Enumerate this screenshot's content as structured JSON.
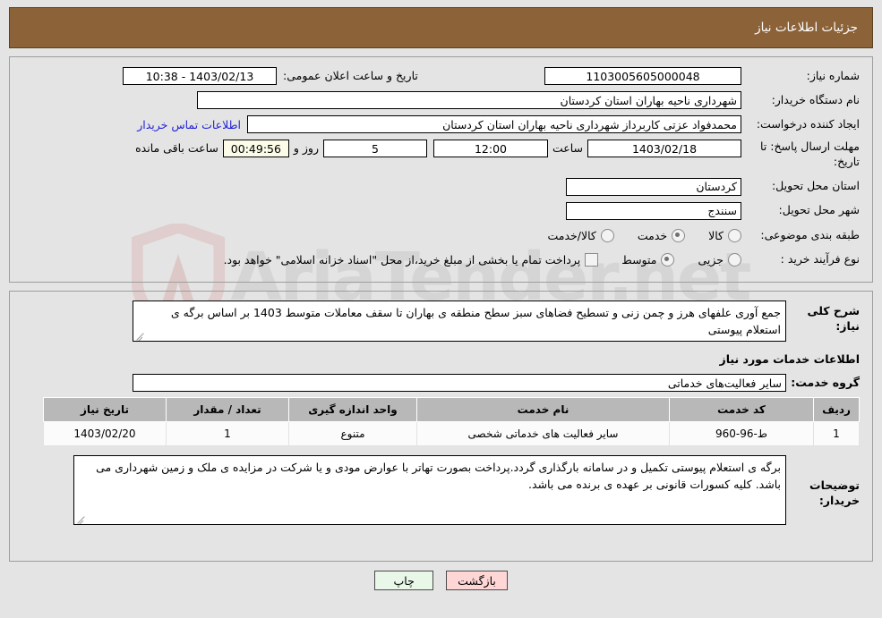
{
  "header": {
    "title": "جزئیات اطلاعات نیاز"
  },
  "form": {
    "need_number_label": "شماره نیاز:",
    "need_number_value": "1103005605000048",
    "announce_datetime_label": "تاریخ و ساعت اعلان عمومی:",
    "announce_datetime_value": "1403/02/13 - 10:38",
    "buyer_org_label": "نام دستگاه خریدار:",
    "buyer_org_value": "شهرداری ناحیه بهاران استان کردستان",
    "creator_label": "ایجاد کننده درخواست:",
    "creator_value": "محمدفواد عزتی کاربرداز شهرداری ناحیه بهاران استان کردستان",
    "contact_link": "اطلاعات تماس خریدار",
    "deadline_label": "مهلت ارسال پاسخ: تا تاریخ:",
    "deadline_date": "1403/02/18",
    "time_label": "ساعت",
    "deadline_time": "12:00",
    "days_value": "5",
    "days_label": "روز و",
    "countdown_value": "00:49:56",
    "countdown_label": "ساعت باقی مانده",
    "province_label": "استان محل تحویل:",
    "province_value": "کردستان",
    "city_label": "شهر محل تحویل:",
    "city_value": "سنندج",
    "category_label": "طبقه بندی موضوعی:",
    "category_options": [
      {
        "label": "کالا",
        "selected": false
      },
      {
        "label": "خدمت",
        "selected": true
      },
      {
        "label": "کالا/خدمت",
        "selected": false
      }
    ],
    "process_label": "نوع فرآیند خرید :",
    "process_options": [
      {
        "label": "جزیی",
        "selected": false
      },
      {
        "label": "متوسط",
        "selected": true
      }
    ],
    "treasury_checkbox_label": "پرداخت تمام یا بخشی از مبلغ خرید،از محل \"اسناد خزانه اسلامی\" خواهد بود.",
    "treasury_checked": false
  },
  "description": {
    "label": "شرح کلی نیاز:",
    "value": "جمع آوری علفهای هرز و چمن زنی و تسطیح فضاهای سبز سطح منطقه ی بهاران تا سقف معاملات متوسط 1403 بر اساس برگه ی استعلام پیوستی"
  },
  "services_section": {
    "heading": "اطلاعات خدمات مورد نیاز",
    "group_label": "گروه خدمت:",
    "group_value": "سایر فعالیت‌های خدماتی"
  },
  "table": {
    "columns": [
      "ردیف",
      "کد خدمت",
      "نام خدمت",
      "واحد اندازه گیری",
      "تعداد / مقدار",
      "تاریخ نیاز"
    ],
    "rows": [
      {
        "row_no": "1",
        "service_code": "ط-96-960",
        "service_name": "سایر فعالیت های خدماتی شخصی",
        "unit": "متنوع",
        "quantity": "1",
        "need_date": "1403/02/20"
      }
    ]
  },
  "buyer_notes": {
    "label": "توضیحات خریدار:",
    "value": "برگه ی استعلام پیوستی تکمیل و در سامانه بارگذاری گردد.پرداخت بصورت تهاتر با عوارض مودی و یا شرکت در مزایده ی ملک و زمین شهرداری می باشد. کلیه کسورات قانونی بر عهده ی برنده می  باشد."
  },
  "footer": {
    "back_button": "بازگشت",
    "print_button": "چاپ"
  },
  "watermark": {
    "text": "AriaTender.net"
  },
  "colors": {
    "header_bg": "#8c6239",
    "page_bg": "#e4e4e4",
    "link": "#2424d6",
    "table_header_bg": "#b8b8b8",
    "back_button_bg": "#ffd6d6",
    "print_button_bg": "#e8f7e8",
    "countdown_bg": "#fbfbe8"
  }
}
